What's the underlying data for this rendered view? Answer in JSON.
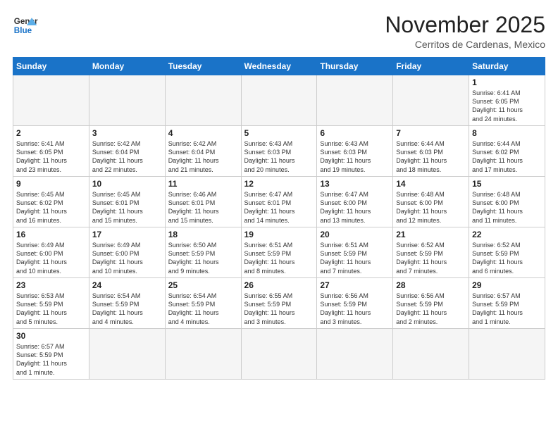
{
  "logo": {
    "line1": "General",
    "line2": "Blue"
  },
  "title": "November 2025",
  "location": "Cerritos de Cardenas, Mexico",
  "weekdays": [
    "Sunday",
    "Monday",
    "Tuesday",
    "Wednesday",
    "Thursday",
    "Friday",
    "Saturday"
  ],
  "weeks": [
    [
      {
        "day": "",
        "info": ""
      },
      {
        "day": "",
        "info": ""
      },
      {
        "day": "",
        "info": ""
      },
      {
        "day": "",
        "info": ""
      },
      {
        "day": "",
        "info": ""
      },
      {
        "day": "",
        "info": ""
      },
      {
        "day": "1",
        "info": "Sunrise: 6:41 AM\nSunset: 6:05 PM\nDaylight: 11 hours\nand 24 minutes."
      }
    ],
    [
      {
        "day": "2",
        "info": "Sunrise: 6:41 AM\nSunset: 6:05 PM\nDaylight: 11 hours\nand 23 minutes."
      },
      {
        "day": "3",
        "info": "Sunrise: 6:42 AM\nSunset: 6:04 PM\nDaylight: 11 hours\nand 22 minutes."
      },
      {
        "day": "4",
        "info": "Sunrise: 6:42 AM\nSunset: 6:04 PM\nDaylight: 11 hours\nand 21 minutes."
      },
      {
        "day": "5",
        "info": "Sunrise: 6:43 AM\nSunset: 6:03 PM\nDaylight: 11 hours\nand 20 minutes."
      },
      {
        "day": "6",
        "info": "Sunrise: 6:43 AM\nSunset: 6:03 PM\nDaylight: 11 hours\nand 19 minutes."
      },
      {
        "day": "7",
        "info": "Sunrise: 6:44 AM\nSunset: 6:03 PM\nDaylight: 11 hours\nand 18 minutes."
      },
      {
        "day": "8",
        "info": "Sunrise: 6:44 AM\nSunset: 6:02 PM\nDaylight: 11 hours\nand 17 minutes."
      }
    ],
    [
      {
        "day": "9",
        "info": "Sunrise: 6:45 AM\nSunset: 6:02 PM\nDaylight: 11 hours\nand 16 minutes."
      },
      {
        "day": "10",
        "info": "Sunrise: 6:45 AM\nSunset: 6:01 PM\nDaylight: 11 hours\nand 15 minutes."
      },
      {
        "day": "11",
        "info": "Sunrise: 6:46 AM\nSunset: 6:01 PM\nDaylight: 11 hours\nand 15 minutes."
      },
      {
        "day": "12",
        "info": "Sunrise: 6:47 AM\nSunset: 6:01 PM\nDaylight: 11 hours\nand 14 minutes."
      },
      {
        "day": "13",
        "info": "Sunrise: 6:47 AM\nSunset: 6:00 PM\nDaylight: 11 hours\nand 13 minutes."
      },
      {
        "day": "14",
        "info": "Sunrise: 6:48 AM\nSunset: 6:00 PM\nDaylight: 11 hours\nand 12 minutes."
      },
      {
        "day": "15",
        "info": "Sunrise: 6:48 AM\nSunset: 6:00 PM\nDaylight: 11 hours\nand 11 minutes."
      }
    ],
    [
      {
        "day": "16",
        "info": "Sunrise: 6:49 AM\nSunset: 6:00 PM\nDaylight: 11 hours\nand 10 minutes."
      },
      {
        "day": "17",
        "info": "Sunrise: 6:49 AM\nSunset: 6:00 PM\nDaylight: 11 hours\nand 10 minutes."
      },
      {
        "day": "18",
        "info": "Sunrise: 6:50 AM\nSunset: 5:59 PM\nDaylight: 11 hours\nand 9 minutes."
      },
      {
        "day": "19",
        "info": "Sunrise: 6:51 AM\nSunset: 5:59 PM\nDaylight: 11 hours\nand 8 minutes."
      },
      {
        "day": "20",
        "info": "Sunrise: 6:51 AM\nSunset: 5:59 PM\nDaylight: 11 hours\nand 7 minutes."
      },
      {
        "day": "21",
        "info": "Sunrise: 6:52 AM\nSunset: 5:59 PM\nDaylight: 11 hours\nand 7 minutes."
      },
      {
        "day": "22",
        "info": "Sunrise: 6:52 AM\nSunset: 5:59 PM\nDaylight: 11 hours\nand 6 minutes."
      }
    ],
    [
      {
        "day": "23",
        "info": "Sunrise: 6:53 AM\nSunset: 5:59 PM\nDaylight: 11 hours\nand 5 minutes."
      },
      {
        "day": "24",
        "info": "Sunrise: 6:54 AM\nSunset: 5:59 PM\nDaylight: 11 hours\nand 4 minutes."
      },
      {
        "day": "25",
        "info": "Sunrise: 6:54 AM\nSunset: 5:59 PM\nDaylight: 11 hours\nand 4 minutes."
      },
      {
        "day": "26",
        "info": "Sunrise: 6:55 AM\nSunset: 5:59 PM\nDaylight: 11 hours\nand 3 minutes."
      },
      {
        "day": "27",
        "info": "Sunrise: 6:56 AM\nSunset: 5:59 PM\nDaylight: 11 hours\nand 3 minutes."
      },
      {
        "day": "28",
        "info": "Sunrise: 6:56 AM\nSunset: 5:59 PM\nDaylight: 11 hours\nand 2 minutes."
      },
      {
        "day": "29",
        "info": "Sunrise: 6:57 AM\nSunset: 5:59 PM\nDaylight: 11 hours\nand 1 minute."
      }
    ],
    [
      {
        "day": "30",
        "info": "Sunrise: 6:57 AM\nSunset: 5:59 PM\nDaylight: 11 hours\nand 1 minute."
      },
      {
        "day": "",
        "info": ""
      },
      {
        "day": "",
        "info": ""
      },
      {
        "day": "",
        "info": ""
      },
      {
        "day": "",
        "info": ""
      },
      {
        "day": "",
        "info": ""
      },
      {
        "day": "",
        "info": ""
      }
    ]
  ]
}
